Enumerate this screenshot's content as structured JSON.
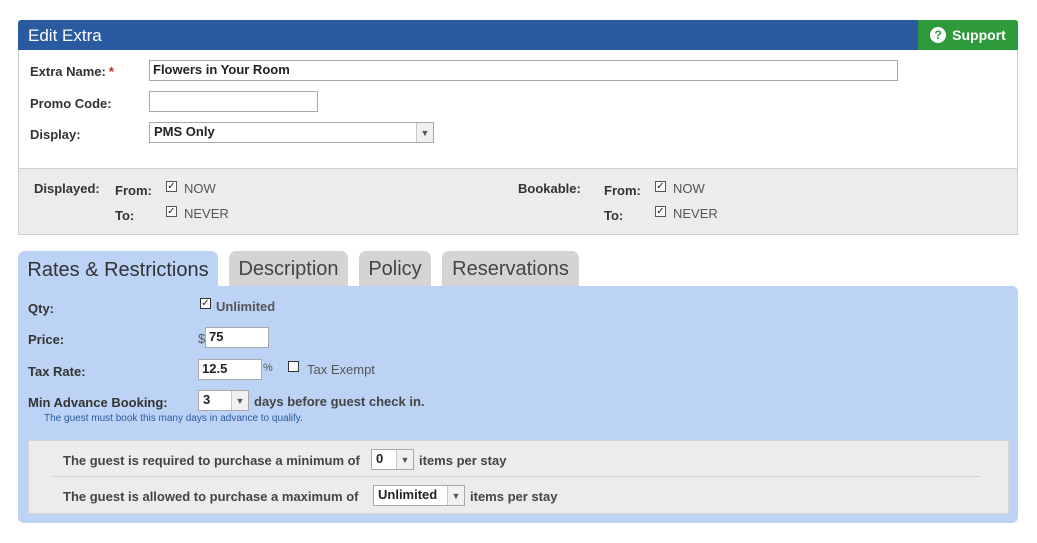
{
  "panel": {
    "title": "Edit Extra",
    "support_label": "Support"
  },
  "form": {
    "extra_name_label": "Extra Name:",
    "required_mark": "*",
    "extra_name_value": "Flowers in Your Room",
    "promo_code_label": "Promo Code:",
    "promo_code_value": "",
    "display_label": "Display:",
    "display_value": "PMS Only"
  },
  "dates": {
    "displayed_label": "Displayed:",
    "bookable_label": "Bookable:",
    "from_label": "From:",
    "to_label": "To:",
    "now_text": "NOW",
    "never_text": "NEVER"
  },
  "tabs": [
    {
      "label": "Rates & Restrictions",
      "active": true
    },
    {
      "label": "Description",
      "active": false
    },
    {
      "label": "Policy",
      "active": false
    },
    {
      "label": "Reservations",
      "active": false
    }
  ],
  "rates": {
    "qty_label": "Qty:",
    "unlimited_label": "Unlimited",
    "price_label": "Price:",
    "currency": "$",
    "price_value": "75",
    "tax_label": "Tax Rate:",
    "tax_value": "12.5",
    "percent": "%",
    "tax_exempt_label": "Tax Exempt",
    "advance_label": "Min Advance Booking:",
    "advance_value": "3",
    "advance_suffix": "days before guest check in.",
    "advance_hint": "The guest must book this many days in advance to qualify.",
    "min_prefix": "The guest is required to purchase a minimum of",
    "min_value": "0",
    "min_suffix": "items per stay",
    "max_prefix": "The guest is allowed to purchase a maximum of",
    "max_value": "Unlimited",
    "max_suffix": "items per stay"
  },
  "colors": {
    "header": "#2a5ba0",
    "support": "#2f9a3b",
    "tab_active": "#bcd3f5"
  },
  "icons": {
    "support": "help-circle-icon",
    "dropdown": "chevron-down-icon",
    "checkbox": "checkmark-icon"
  }
}
